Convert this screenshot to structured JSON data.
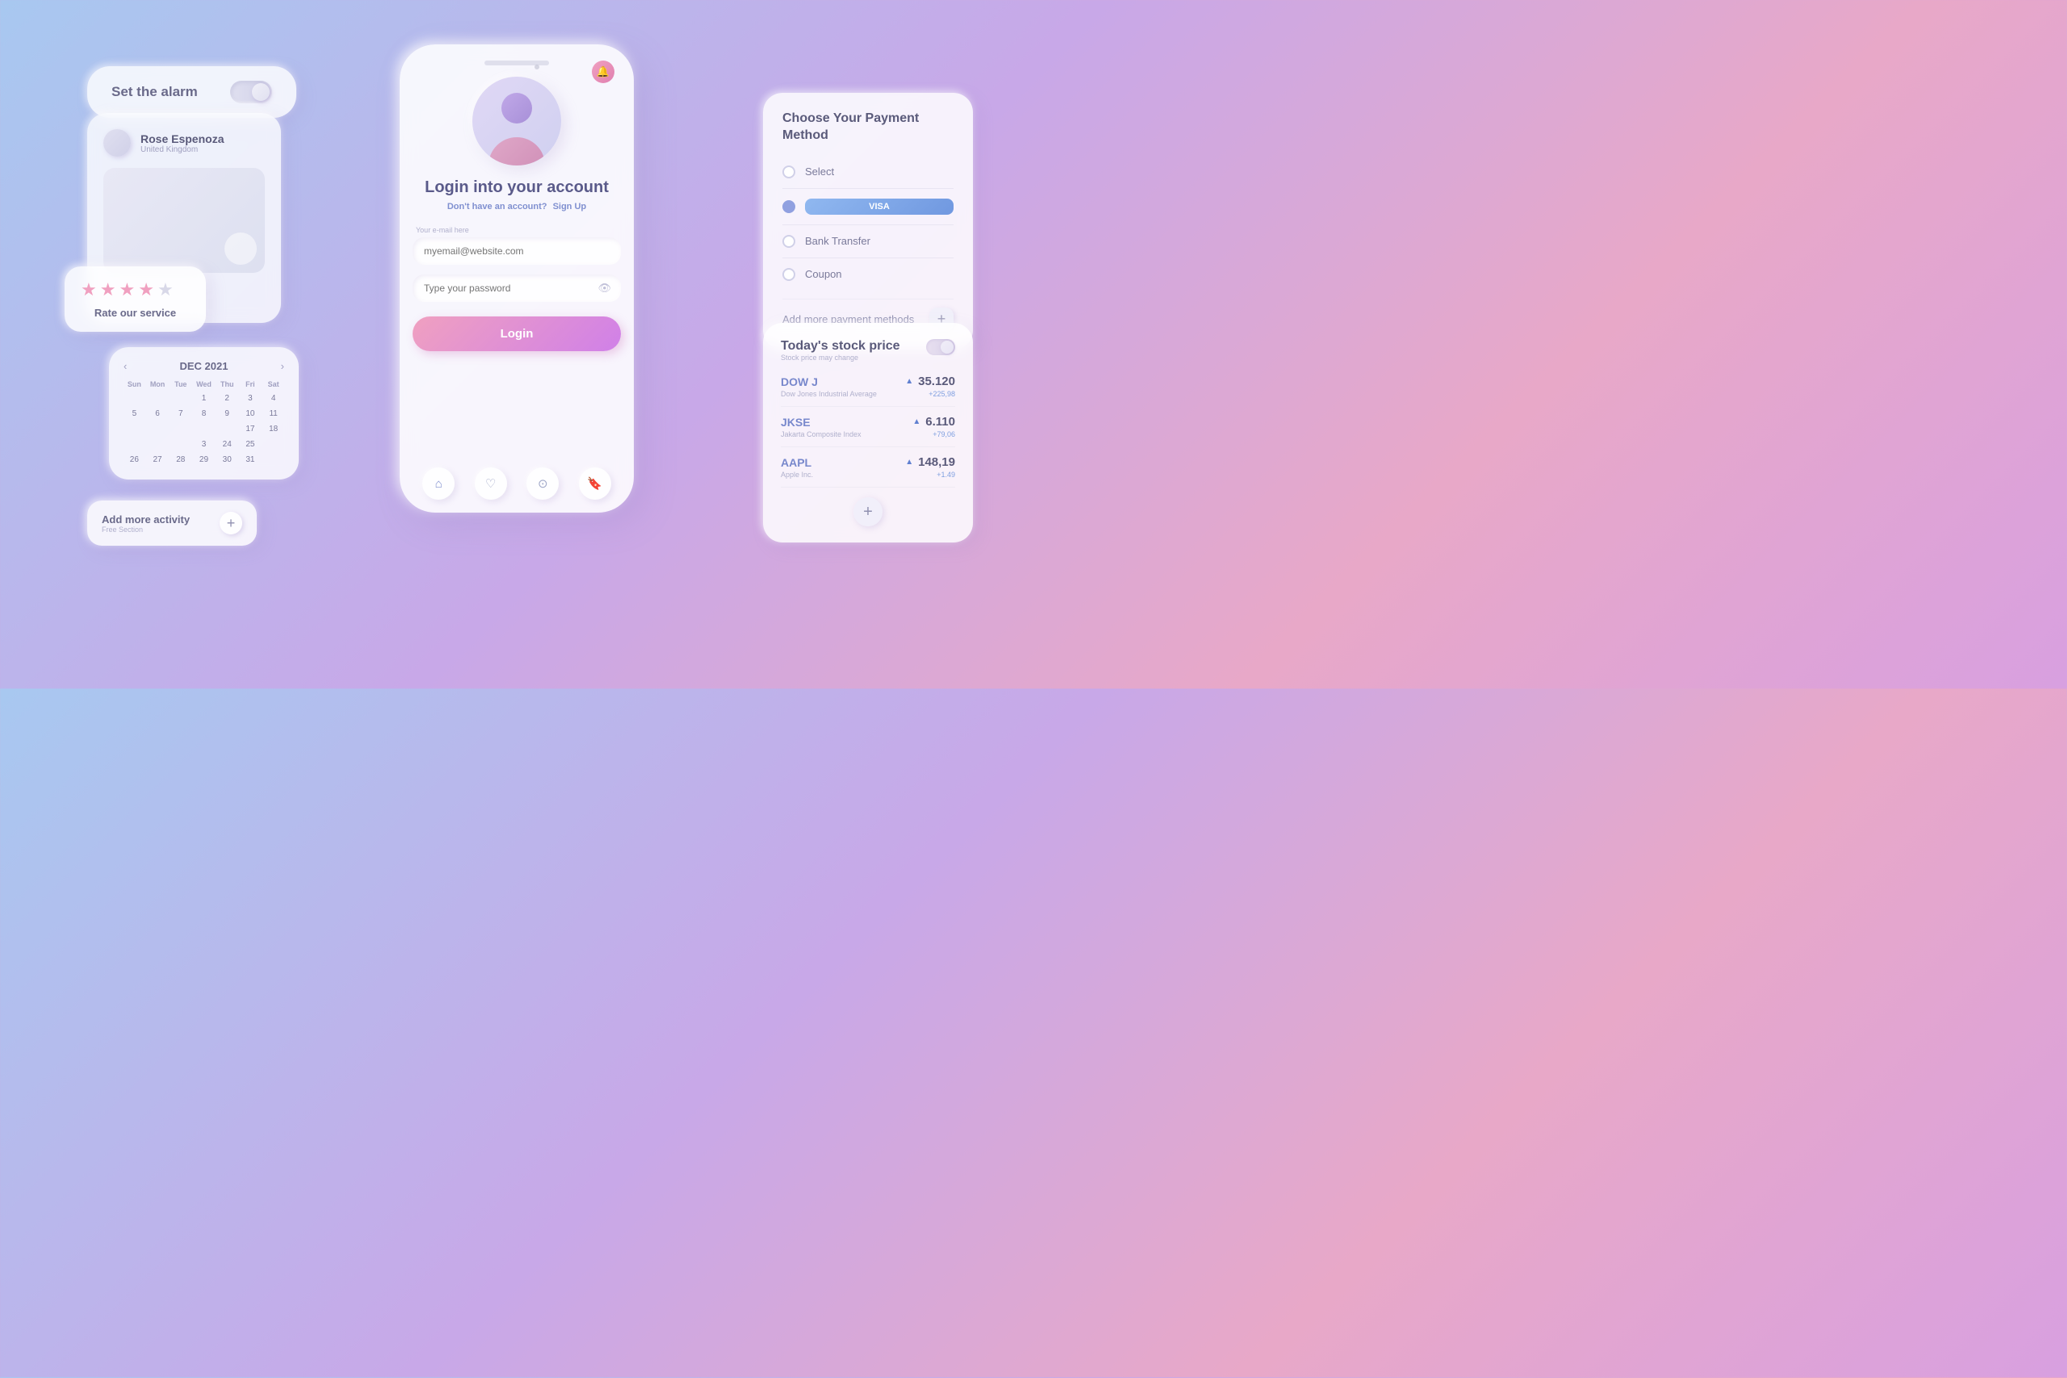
{
  "background": {
    "gradient": "linear-gradient(135deg, #a8c8f0 0%, #c8a8e8 40%, #e8a8c8 70%, #d8a0e0 100%)"
  },
  "alarm": {
    "label": "Set the alarm"
  },
  "profile": {
    "name": "Rose Espenoza",
    "location": "United Kingdom"
  },
  "rating": {
    "label": "Rate our service",
    "stars": 4,
    "total_stars": 5
  },
  "calendar": {
    "month_label": "DEC 2021",
    "day_headers": [
      "Sun",
      "Mon",
      "Tue",
      "Wed",
      "Thu",
      "Fri",
      "Sat"
    ],
    "days": [
      {
        "val": "",
        "empty": true
      },
      {
        "val": "",
        "empty": true
      },
      {
        "val": "",
        "empty": true
      },
      {
        "val": "1"
      },
      {
        "val": "2"
      },
      {
        "val": "3"
      },
      {
        "val": "4"
      },
      {
        "val": "5"
      },
      {
        "val": "6"
      },
      {
        "val": "7"
      },
      {
        "val": "8"
      },
      {
        "val": "9"
      },
      {
        "val": "10"
      },
      {
        "val": "11"
      },
      {
        "val": ""
      },
      {
        "val": ""
      },
      {
        "val": ""
      },
      {
        "val": ""
      },
      {
        "val": ""
      },
      {
        "val": "17"
      },
      {
        "val": "18"
      },
      {
        "val": ""
      },
      {
        "val": ""
      },
      {
        "val": ""
      },
      {
        "val": "3"
      },
      {
        "val": "24"
      },
      {
        "val": "25"
      },
      {
        "val": ""
      },
      {
        "val": "26"
      },
      {
        "val": "27"
      },
      {
        "val": "28"
      },
      {
        "val": "29"
      },
      {
        "val": "30"
      },
      {
        "val": "31"
      },
      {
        "val": ""
      }
    ]
  },
  "activity": {
    "title": "Add more activity",
    "subtitle": "Free Section"
  },
  "phone": {
    "bell_icon": "🔔",
    "login_title": "Login into your account",
    "login_sub_prefix": "Don't have an account?",
    "login_sub_link": "Sign Up",
    "email_label": "Your e-mail here",
    "email_placeholder": "myemail@website.com",
    "password_placeholder": "Type your password",
    "login_btn": "Login",
    "nav": [
      "🏠",
      "♡",
      "⊙",
      "🔖"
    ]
  },
  "payment": {
    "title": "Choose Your Payment Method",
    "options": [
      {
        "label": "Select",
        "type": "text",
        "selected": false
      },
      {
        "label": "VISA",
        "type": "visa",
        "selected": true
      },
      {
        "label": "Bank Transfer",
        "type": "text",
        "selected": false
      },
      {
        "label": "Coupon",
        "type": "text",
        "selected": false
      }
    ],
    "add_label": "Add more payment methods"
  },
  "stock": {
    "title": "Today's stock price",
    "subtitle": "Stock price may change",
    "rows": [
      {
        "ticker": "DOW J",
        "name": "Dow Jones Industrial Average",
        "value": "35.120",
        "change": "+225,98"
      },
      {
        "ticker": "JKSE",
        "name": "Jakarta Composite Index",
        "value": "6.110",
        "change": "+79,06"
      },
      {
        "ticker": "AAPL",
        "name": "Apple Inc.",
        "value": "148,19",
        "change": "+1.49"
      }
    ]
  }
}
